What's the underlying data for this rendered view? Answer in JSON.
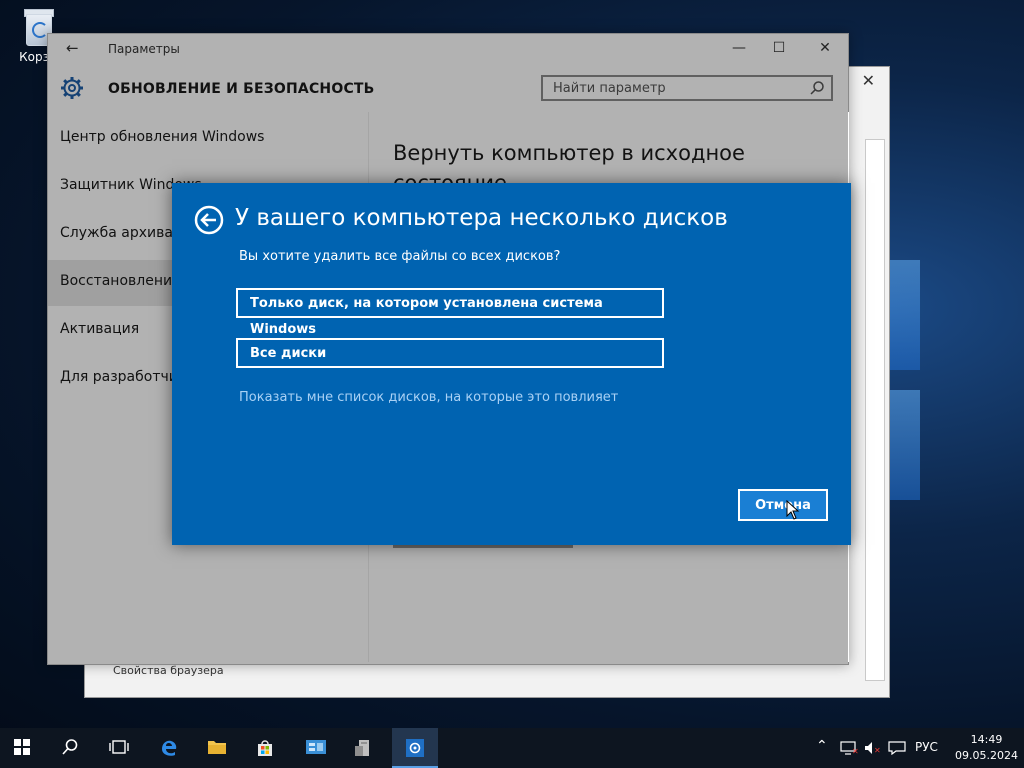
{
  "desktop": {
    "recycle_bin_label": "Корзи"
  },
  "back_window": {
    "bottom_link": "Свойства браузера"
  },
  "settings_window": {
    "title": "Параметры",
    "section_title": "ОБНОВЛЕНИЕ И БЕЗОПАСНОСТЬ",
    "search_placeholder": "Найти параметр",
    "nav": [
      {
        "label": "Центр обновления Windows"
      },
      {
        "label": "Защитник Windows"
      },
      {
        "label": "Служба архивац"
      },
      {
        "label": "Восстановление"
      },
      {
        "label": "Активация"
      },
      {
        "label": "Для разработчик"
      }
    ],
    "content_heading": "Вернуть компьютер в исходное состояние"
  },
  "modal": {
    "title": "У вашего компьютера несколько дисков",
    "question": "Вы хотите удалить все файлы со всех дисков?",
    "option_system_drive": "Только диск, на котором установлена система Windows",
    "option_all_drives": "Все диски",
    "show_drives_link": "Показать мне список дисков, на которые это повлияет",
    "cancel_label": "Отмена"
  },
  "taskbar": {
    "language": "РУС",
    "time": "14:49",
    "date": "09.05.2024"
  },
  "colors": {
    "modal_bg": "#0063b1",
    "link_color": "#a9d1f5",
    "taskbar_bg": "#0d1520"
  }
}
